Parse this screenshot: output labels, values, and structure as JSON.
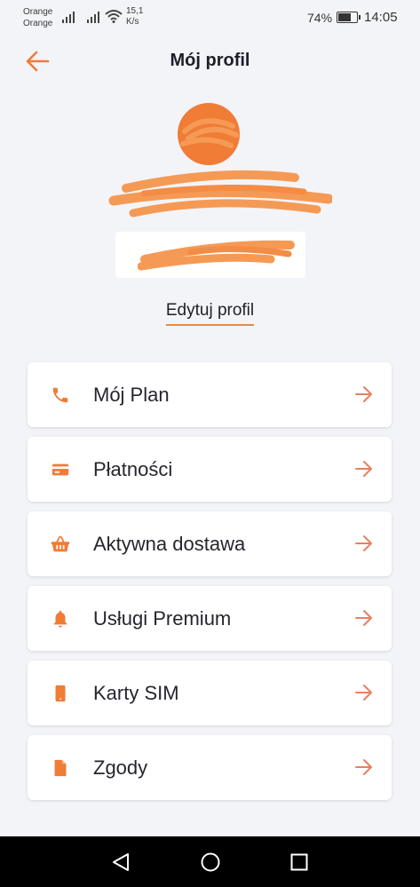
{
  "status_bar": {
    "carrier_1": "Orange",
    "carrier_2": "Orange",
    "speed_value": "15,1",
    "speed_unit": "K/s",
    "battery_percent": "74%",
    "battery_level": 0.74,
    "time": "14:05"
  },
  "header": {
    "title": "Mój profil",
    "back_icon": "arrow-left-icon"
  },
  "profile": {
    "edit_label": "Edytuj profil"
  },
  "menu": {
    "items": [
      {
        "label": "Mój Plan",
        "icon": "phone-icon"
      },
      {
        "label": "Płatności",
        "icon": "credit-card-icon"
      },
      {
        "label": "Aktywna dostawa",
        "icon": "basket-icon"
      },
      {
        "label": "Usługi Premium",
        "icon": "bell-icon"
      },
      {
        "label": "Karty SIM",
        "icon": "mobile-icon"
      },
      {
        "label": "Zgody",
        "icon": "document-icon"
      }
    ]
  },
  "colors": {
    "accent": "#f07c36",
    "arrow": "#e8805f",
    "background": "#f3f4f8"
  }
}
